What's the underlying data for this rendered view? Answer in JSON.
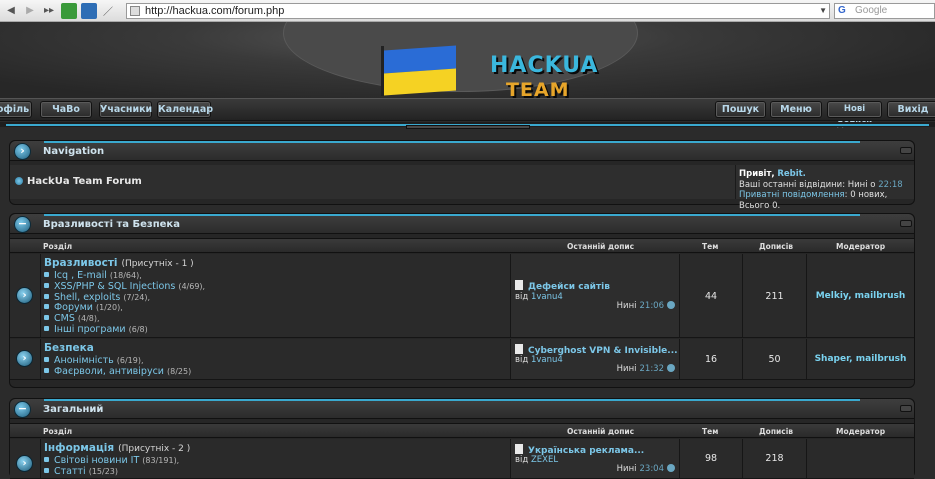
{
  "browser": {
    "url": "http://hackua.com/forum.php",
    "search_placeholder": "Google"
  },
  "header": {
    "logo_line1": "HACKUA",
    "logo_line2": "TEAM"
  },
  "navbar": {
    "profile": "офіль",
    "faq": "ЧаВо",
    "members": "Учасники",
    "calendar": "Календар",
    "search": "Пошук",
    "menu": "Меню",
    "new_posts": "Нові дописи",
    "logout": "Вихід"
  },
  "navigation_panel": {
    "title": "Navigation",
    "forum_name": "HackUa Team Forum",
    "greeting": "Привіт,",
    "username": "Rebit.",
    "last_visit_label": "Ваші останні відвідини: Нині о",
    "last_visit_time": "22:18",
    "pm_label": "Приватні повідомлення",
    "pm_status": ": 0 нових, Всього 0."
  },
  "columns": {
    "section": "Розділ",
    "last_post": "Останній допис",
    "topics": "Тем",
    "posts": "Дописів",
    "moderator": "Модератор"
  },
  "categories": [
    {
      "title": "Вразливості та Безпека",
      "forums": [
        {
          "title": "Вразливості",
          "present": "(Присутніх - 1 )",
          "subforums": [
            {
              "name": "Icq , E-mail",
              "count": "(18/64),"
            },
            {
              "name": "XSS/PHP & SQL Injections",
              "count": "(4/69),"
            },
            {
              "name": "Shell, exploits",
              "count": "(7/24),"
            },
            {
              "name": "Форуми",
              "count": "(1/20),"
            },
            {
              "name": "CMS",
              "count": "(4/8),"
            },
            {
              "name": "Інші програми",
              "count": "(6/8)"
            }
          ],
          "last_post": {
            "title": "Дефейси сайтів",
            "by_label": "від",
            "author": "1vanu4",
            "day": "Нині",
            "time": "21:06"
          },
          "topics": "44",
          "posts": "211",
          "moderators": "Melkiy, mailbrush"
        },
        {
          "title": "Безпека",
          "present": "",
          "subforums": [
            {
              "name": "Анонімність",
              "count": "(6/19),"
            },
            {
              "name": "Фаєрволи, антивіруси",
              "count": "(8/25)"
            }
          ],
          "last_post": {
            "title": "Cyberghost VPN & Invisible...",
            "by_label": "від",
            "author": "1vanu4",
            "day": "Нині",
            "time": "21:32"
          },
          "topics": "16",
          "posts": "50",
          "moderators": "Shaper, mailbrush"
        }
      ]
    },
    {
      "title": "Загальний",
      "forums": [
        {
          "title": "Інформація",
          "present": "(Присутніх - 2 )",
          "subforums": [
            {
              "name": "Світові новини IT",
              "count": "(83/191),"
            },
            {
              "name": "Статті",
              "count": "(15/23)"
            }
          ],
          "last_post": {
            "title": "Українська реклама...",
            "by_label": "від",
            "author": "ZEXEL",
            "day": "Нині",
            "time": "23:04"
          },
          "topics": "98",
          "posts": "218",
          "moderators": ""
        }
      ]
    }
  ]
}
